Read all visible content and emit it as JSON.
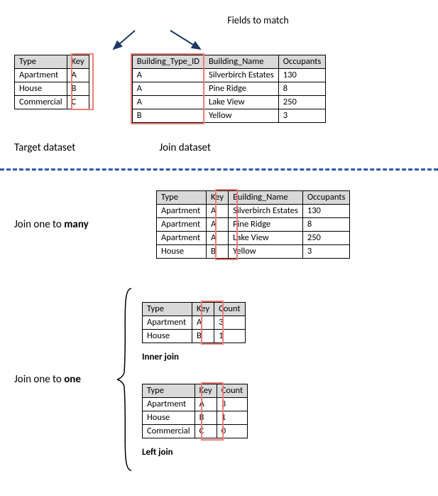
{
  "header_label": "Fields to match",
  "target": {
    "caption": "Target dataset",
    "cols": [
      "Type",
      "Key"
    ],
    "rows": [
      [
        "Apartment",
        "A"
      ],
      [
        "House",
        "B"
      ],
      [
        "Commercial",
        "C"
      ]
    ]
  },
  "join": {
    "caption": "Join dataset",
    "cols": [
      "Building_Type_ID",
      "Building_Name",
      "Occupants"
    ],
    "rows": [
      [
        "A",
        "Silverbirch Estates",
        "130"
      ],
      [
        "A",
        "Pine Ridge",
        "8"
      ],
      [
        "A",
        "Lake View",
        "250"
      ],
      [
        "B",
        "Yellow",
        "3"
      ]
    ]
  },
  "one_to_many": {
    "label_pre": "Join one to ",
    "label_bold": "many",
    "cols": [
      "Type",
      "Key",
      "Building_Name",
      "Occupants"
    ],
    "rows": [
      [
        "Apartment",
        "A",
        "Silverbirch Estates",
        "130"
      ],
      [
        "Apartment",
        "A",
        "Pine Ridge",
        "8"
      ],
      [
        "Apartment",
        "A",
        "Lake View",
        "250"
      ],
      [
        "House",
        "B",
        "Yellow",
        "3"
      ]
    ]
  },
  "one_to_one": {
    "label_pre": "Join one to ",
    "label_bold": "one",
    "inner": {
      "caption": "Inner join",
      "cols": [
        "Type",
        "Key",
        "Count"
      ],
      "rows": [
        [
          "Apartment",
          "A",
          "3"
        ],
        [
          "House",
          "B",
          "1"
        ]
      ]
    },
    "left": {
      "caption": "Left join",
      "cols": [
        "Type",
        "Key",
        "Count"
      ],
      "rows": [
        [
          "Apartment",
          "A",
          "3"
        ],
        [
          "House",
          "B",
          "1"
        ],
        [
          "Commercial",
          "C",
          "0"
        ]
      ]
    }
  },
  "highlight_color": "#ed7d74"
}
